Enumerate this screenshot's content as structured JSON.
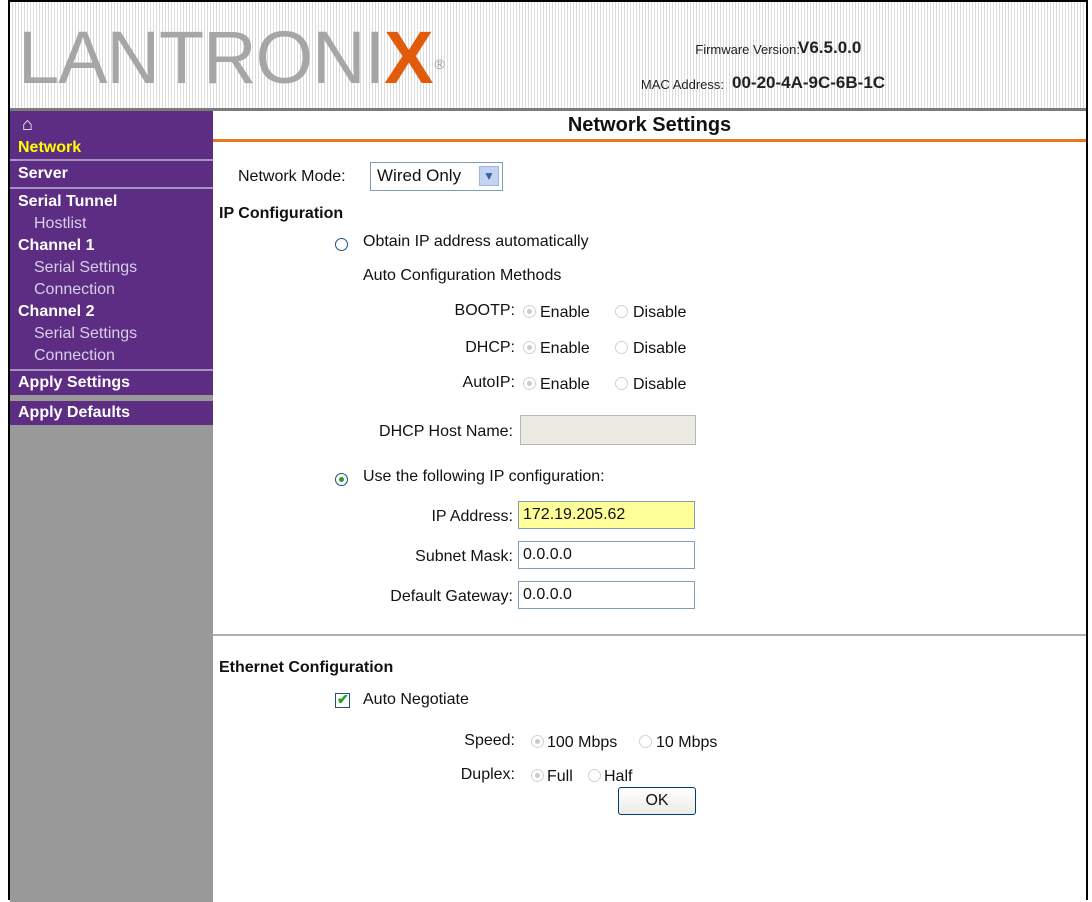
{
  "header": {
    "logo_text": "LANTRONIX",
    "logo_mark": "®",
    "firmware_label": "Firmware Version:",
    "firmware_value": "V6.5.0.0",
    "mac_label": "MAC Address:",
    "mac_value": "00-20-4A-9C-6B-1C"
  },
  "sidebar": {
    "home_icon": "home-icon",
    "items": [
      {
        "label": "Network",
        "type": "top",
        "active": true
      },
      {
        "label": "Server",
        "type": "top"
      },
      {
        "label": "Serial Tunnel",
        "type": "top"
      },
      {
        "label": "Hostlist",
        "type": "sub"
      },
      {
        "label": "Channel 1",
        "type": "top"
      },
      {
        "label": "Serial Settings",
        "type": "sub"
      },
      {
        "label": "Connection",
        "type": "sub"
      },
      {
        "label": "Channel 2",
        "type": "top"
      },
      {
        "label": "Serial Settings",
        "type": "sub"
      },
      {
        "label": "Connection",
        "type": "sub"
      },
      {
        "label": "Apply Settings",
        "type": "top"
      },
      {
        "label": "Apply Defaults",
        "type": "top"
      }
    ]
  },
  "page": {
    "title": "Network Settings",
    "network_mode_label": "Network Mode:",
    "network_mode_value": "Wired Only",
    "ip_config_heading": "IP Configuration",
    "obtain_auto_label": "Obtain IP address automatically",
    "auto_methods_label": "Auto Configuration Methods",
    "bootp_label": "BOOTP:",
    "dhcp_label": "DHCP:",
    "autoip_label": "AutoIP:",
    "enable_label": "Enable",
    "disable_label": "Disable",
    "dhcp_host_label": "DHCP Host Name:",
    "dhcp_host_value": "",
    "use_following_label": "Use the following IP configuration:",
    "ip_address_label": "IP Address:",
    "ip_address_value": "172.19.205.62",
    "subnet_label": "Subnet Mask:",
    "subnet_value": "0.0.0.0",
    "gateway_label": "Default Gateway:",
    "gateway_value": "0.0.0.0",
    "ethernet_heading": "Ethernet Configuration",
    "auto_negotiate_label": "Auto Negotiate",
    "auto_negotiate_checked": true,
    "speed_label": "Speed:",
    "speed_100": "100 Mbps",
    "speed_10": "10 Mbps",
    "duplex_label": "Duplex:",
    "duplex_full": "Full",
    "duplex_half": "Half",
    "ok_label": "OK"
  },
  "colors": {
    "sidebar_purple": "#5c2d82",
    "active_nav": "#ffff00",
    "title_underline": "#e8781f",
    "logo_x": "#e25b0b",
    "ip_field_highlight": "#ffff99"
  }
}
